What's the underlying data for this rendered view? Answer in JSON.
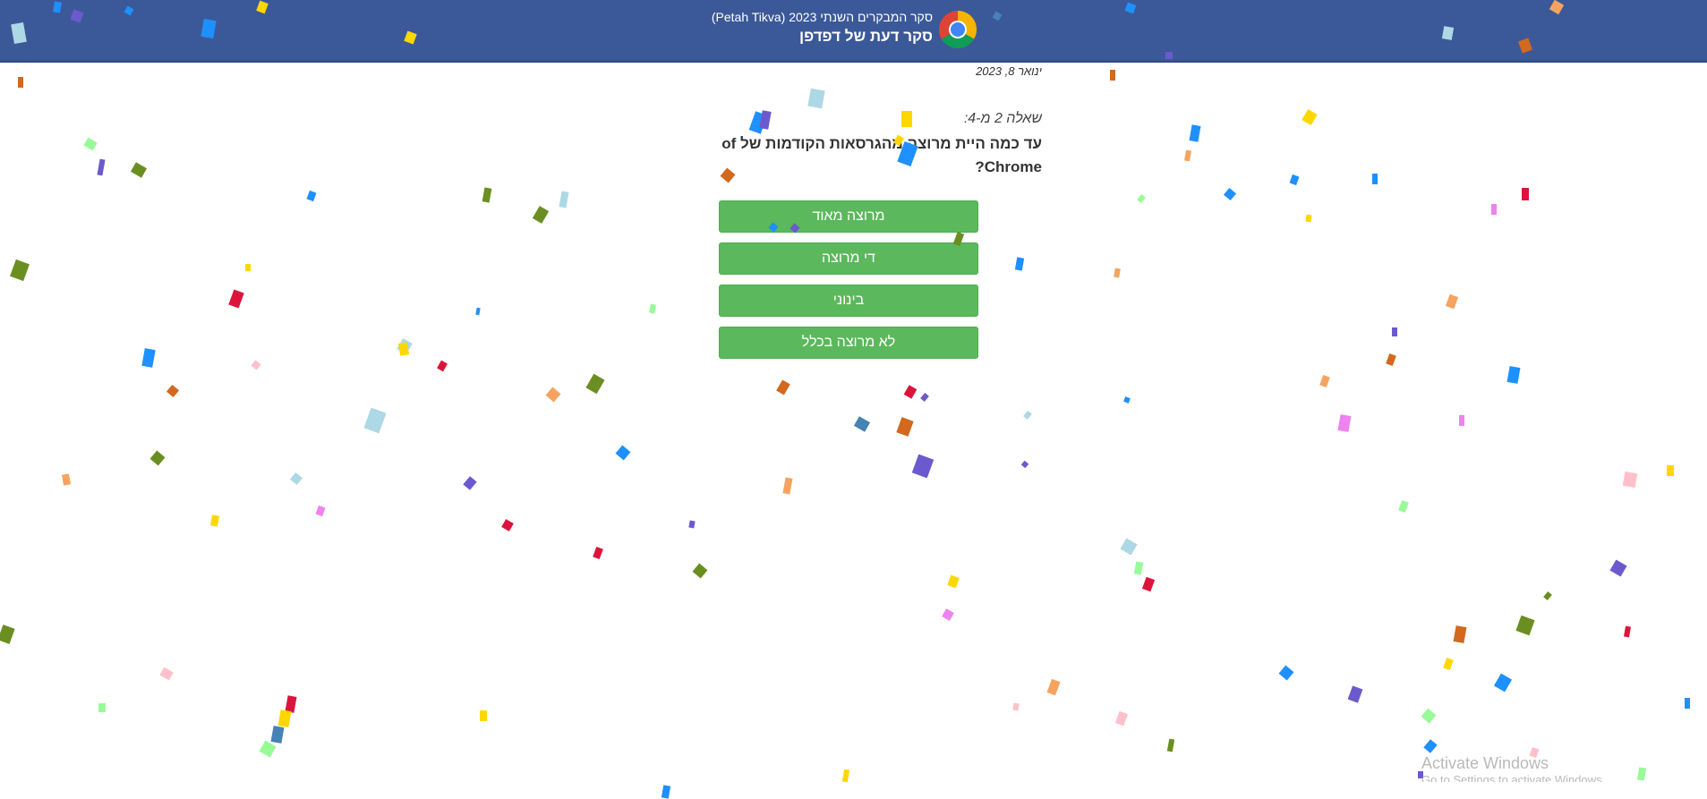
{
  "header": {
    "subtitle": "סקר המבקרים השנתי 2023 (Petah Tikva)",
    "title": "סקר דעת של דפדפן",
    "logo_icon": "chrome-logo-icon"
  },
  "survey": {
    "date": "ינואר 8, 2023",
    "question_counter": "שאלה 2 מ-4:",
    "question_text": "עד כמה היית מרוצה מהגרסאות הקודמות של of Chrome?",
    "answers": [
      {
        "label": "מרוצה מאוד"
      },
      {
        "label": "די מרוצה"
      },
      {
        "label": "בינוני"
      },
      {
        "label": "לא מרוצה בכלל"
      }
    ]
  },
  "colors": {
    "header_bg": "#3b5998",
    "answer_bg": "#5cb85c",
    "confetti": [
      "#1e90ff",
      "#6b8e23",
      "#ffd700",
      "#ffc0cb",
      "#6a5acd",
      "#add8e6",
      "#ee82ee",
      "#98fb98",
      "#4682b4",
      "#f4a460",
      "#d2691e",
      "#dc143c"
    ]
  },
  "os_watermark": {
    "title": "Activate Windows",
    "subtitle": "Go to Settings to activate Windows."
  }
}
